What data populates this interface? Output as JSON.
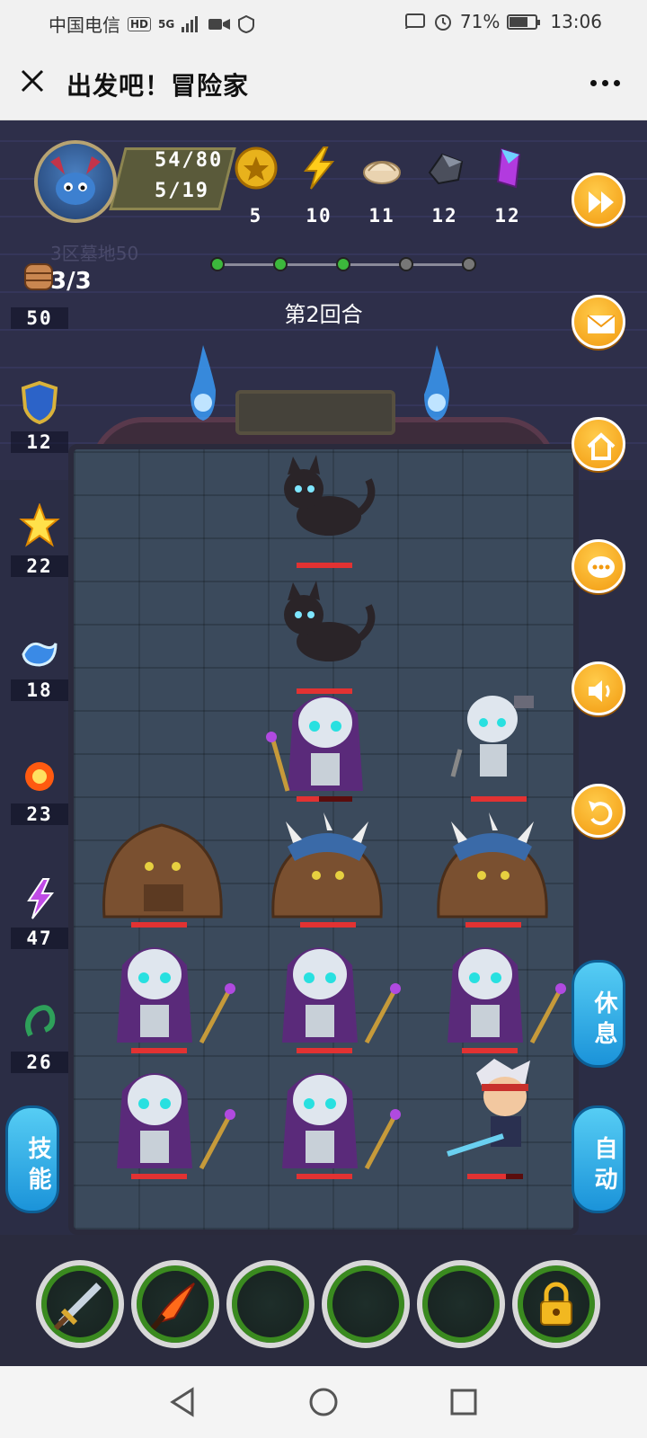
{
  "status_bar": {
    "carrier": "中国电信",
    "hd_badge": "HD",
    "network": "5G",
    "battery_pct": "71%",
    "battery_level": 0.71,
    "time": "13:06"
  },
  "title_bar": {
    "title": "出发吧！冒险家"
  },
  "player": {
    "hp": "54/80",
    "level": "5/19"
  },
  "resources": [
    {
      "icon": "gold-coin-icon",
      "value": "5"
    },
    {
      "icon": "lightning-icon",
      "value": "10"
    },
    {
      "icon": "dumpling-icon",
      "value": "11"
    },
    {
      "icon": "iron-ore-icon",
      "value": "12"
    },
    {
      "icon": "crystal-icon",
      "value": "12"
    }
  ],
  "sub_label": "3区墓地50",
  "progress": {
    "total": 5,
    "completed": 3
  },
  "round_label": "第2回合",
  "left_stats": {
    "fist_count": "3/3",
    "items": [
      {
        "icon": "fist-icon",
        "value": "50"
      },
      {
        "icon": "shield-icon",
        "value": "12"
      },
      {
        "icon": "holy-light-icon",
        "value": "22"
      },
      {
        "icon": "water-wave-icon",
        "value": "18"
      },
      {
        "icon": "fire-icon",
        "value": "23"
      },
      {
        "icon": "lightning-purple-icon",
        "value": "47"
      },
      {
        "icon": "poison-icon",
        "value": "26"
      }
    ]
  },
  "right_buttons": [
    {
      "icon": "fast-forward-icon"
    },
    {
      "icon": "mail-icon"
    },
    {
      "icon": "home-icon"
    },
    {
      "icon": "chat-icon"
    },
    {
      "icon": "sound-icon"
    },
    {
      "icon": "undo-icon"
    }
  ],
  "pills": {
    "rest": "休息",
    "auto": "自动",
    "skill": "技能"
  },
  "colors": {
    "accent_orange": "#f29a10",
    "pill_blue": "#1b93d9",
    "hp_red": "#e23232",
    "progress_green": "#3cb83c"
  },
  "skill_slots": [
    {
      "icon": "sword-icon",
      "state": "equipped"
    },
    {
      "icon": "flame-blade-icon",
      "state": "equipped"
    },
    {
      "icon": "empty-slot",
      "state": "empty"
    },
    {
      "icon": "empty-slot",
      "state": "empty"
    },
    {
      "icon": "empty-slot",
      "state": "empty"
    },
    {
      "icon": "lock-icon",
      "state": "locked"
    }
  ]
}
